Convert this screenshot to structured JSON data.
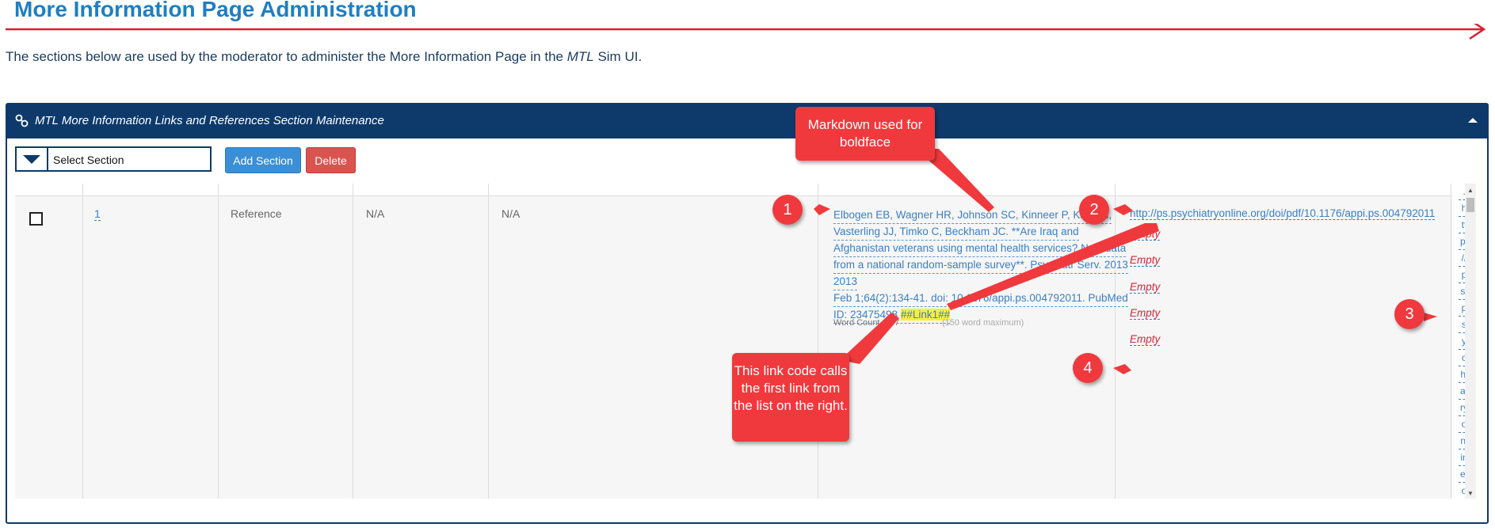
{
  "page": {
    "title": "More Information Page Administration",
    "intro_before": "The sections below are used by the moderator to administer the More Information Page in the ",
    "intro_em": "MTL",
    "intro_after": " Sim UI."
  },
  "panel": {
    "title": "MTL More Information Links and References Section Maintenance",
    "icon": "link-icon",
    "collapse_icon": "chevron-up-icon"
  },
  "toolbar": {
    "select_label": "Select Section",
    "add_label": "Add Section",
    "delete_label": "Delete"
  },
  "row": {
    "number": "1",
    "type": "Reference",
    "col3": "N/A",
    "col4": "N/A",
    "reference_lines": [
      "Elbogen EB, Wagner HR, Johnson SC, Kinneer P, Kang H,",
      "Vasterling JJ, Timko C, Beckham JC. **Are Iraq and",
      "Afghanistan veterans using mental health services? New data",
      "from a national random-sample survey**. Psychiatr Serv. 2013",
      "2013",
      "Feb 1;64(2):134-41. doi: 10.1176/appi.ps.004792011. PubMed",
      "ID: 23475498 "
    ],
    "link_code": "##Link1##",
    "word_count_label": "Word Count = 47",
    "word_max_label": "(150 word maximum)",
    "url": "http://ps.psychiatryonline.org/doi/pdf/10.1176/appi.ps.004792011",
    "empty_label": "Empty",
    "vertical_url": [
      ".",
      "h",
      "tt",
      "p:",
      "//",
      "p",
      "s.",
      "p",
      "s",
      "y",
      "c",
      "hi",
      "at",
      "ry",
      "o",
      "nl",
      "in",
      "e.",
      "o"
    ]
  },
  "callouts": {
    "markdown": "Markdown used for boldface",
    "linkcode": "This link code calls the first link from the list on the right.",
    "badge1": "1",
    "badge2": "2",
    "badge3": "3",
    "badge4": "4"
  },
  "colors": {
    "title_blue": "#1f7fc1",
    "panel_navy": "#0e3a6b",
    "rule_red": "#d4202f",
    "callout_red": "#f0393d",
    "link_blue": "#3a7fc3",
    "empty_red": "#d0263a"
  }
}
